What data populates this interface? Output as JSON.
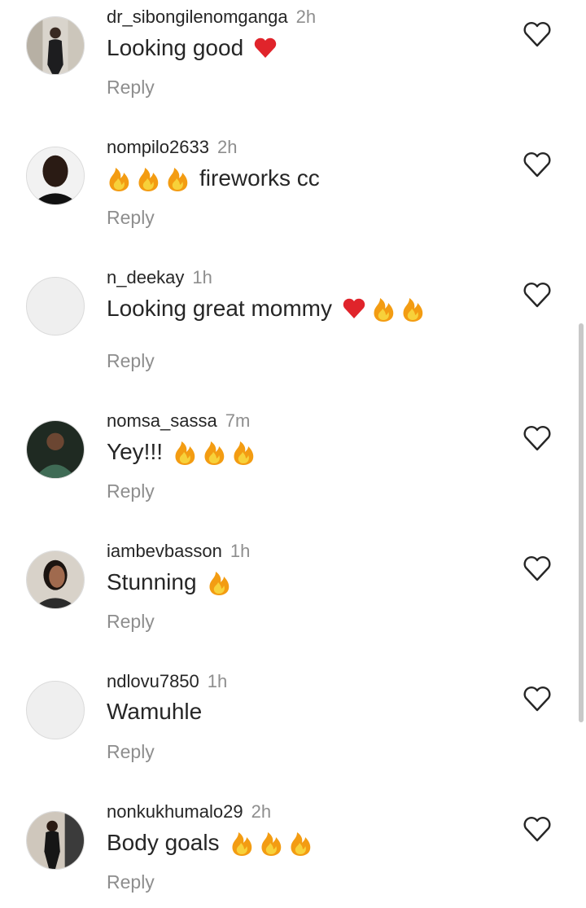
{
  "comments": [
    {
      "username": "dr_sibongilenomganga",
      "time": "2h",
      "text": "Looking good",
      "emojis": [
        "heart"
      ],
      "reply": "Reply",
      "avatar": "photo"
    },
    {
      "username": "nompilo2633",
      "time": "2h",
      "text": "fireworks cc",
      "emojis_before": [
        "fire",
        "fire",
        "fire"
      ],
      "reply": "Reply",
      "avatar": "photo"
    },
    {
      "username": "n_deekay",
      "time": "1h",
      "text": "Looking great mommy",
      "emojis": [
        "heart",
        "fire",
        "fire"
      ],
      "reply": "Reply",
      "avatar": "blank"
    },
    {
      "username": "nomsa_sassa",
      "time": "7m",
      "text": "Yey!!!",
      "emojis": [
        "fire",
        "fire",
        "fire"
      ],
      "reply": "Reply",
      "avatar": "photo"
    },
    {
      "username": "iambevbasson",
      "time": "1h",
      "text": "Stunning",
      "emojis": [
        "fire"
      ],
      "reply": "Reply",
      "avatar": "photo"
    },
    {
      "username": "ndlovu7850",
      "time": "1h",
      "text": "Wamuhle",
      "emojis": [],
      "reply": "Reply",
      "avatar": "blank"
    },
    {
      "username": "nonkukhumalo29",
      "time": "2h",
      "text": "Body goals",
      "emojis": [
        "fire",
        "fire",
        "fire"
      ],
      "reply": "Reply",
      "avatar": "photo"
    }
  ],
  "icons": {
    "like": "heart-outline-icon",
    "fire": "fire-emoji",
    "heart": "red-heart-emoji"
  },
  "colors": {
    "username": "#262626",
    "meta": "#8e8e8e",
    "heart_emoji": "#e0242b",
    "fire_outer": "#f39c12",
    "fire_inner": "#f7d13a"
  }
}
